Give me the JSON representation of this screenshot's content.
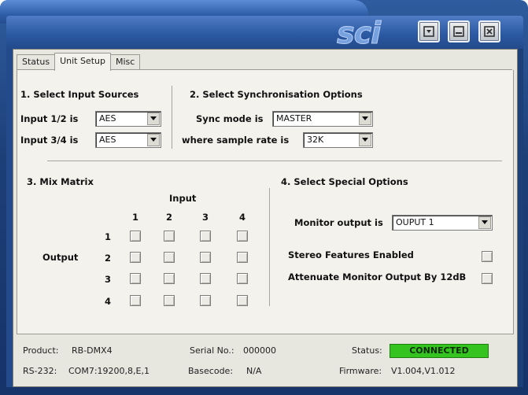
{
  "window": {
    "logo_text": "sci",
    "buttons": {
      "minimize_icon": "minimize-icon",
      "restore_icon": "restore-icon",
      "close_icon": "close-icon"
    }
  },
  "tabs": [
    {
      "label": "Status",
      "active": false
    },
    {
      "label": "Unit Setup",
      "active": true
    },
    {
      "label": "Misc",
      "active": false
    }
  ],
  "section1": {
    "heading": "1. Select Input Sources",
    "input12_label": "Input 1/2 is",
    "input12_value": "AES",
    "input34_label": "Input 3/4 is",
    "input34_value": "AES"
  },
  "section2": {
    "heading": "2. Select Synchronisation Options",
    "sync_label": "Sync mode is",
    "sync_value": "MASTER",
    "rate_label": "where sample rate is",
    "rate_value": "32K"
  },
  "section3": {
    "heading": "3. Mix Matrix",
    "input_label": "Input",
    "output_label": "Output",
    "columns": [
      "1",
      "2",
      "3",
      "4"
    ],
    "rows": [
      "1",
      "2",
      "3",
      "4"
    ]
  },
  "section4": {
    "heading": "4. Select Special  Options",
    "monitor_label": "Monitor output is",
    "monitor_value": "OUPUT 1",
    "stereo_label": "Stereo Features Enabled",
    "attenuate_label": "Attenuate Monitor Output By 12dB"
  },
  "status_bar": {
    "product_label": "Product:",
    "product_value": "RB-DMX4",
    "serial_label": "Serial No.:",
    "serial_value": "000000",
    "status_label": "Status:",
    "status_value": "CONNECTED",
    "rs232_label": "RS-232:",
    "rs232_value": "COM7:19200,8,E,1",
    "basecode_label": "Basecode:",
    "basecode_value": "N/A",
    "firmware_label": "Firmware:",
    "firmware_value": "V1.004,V1.012"
  },
  "colors": {
    "connected": "#35c41f",
    "chrome": "#2c5aa3"
  }
}
